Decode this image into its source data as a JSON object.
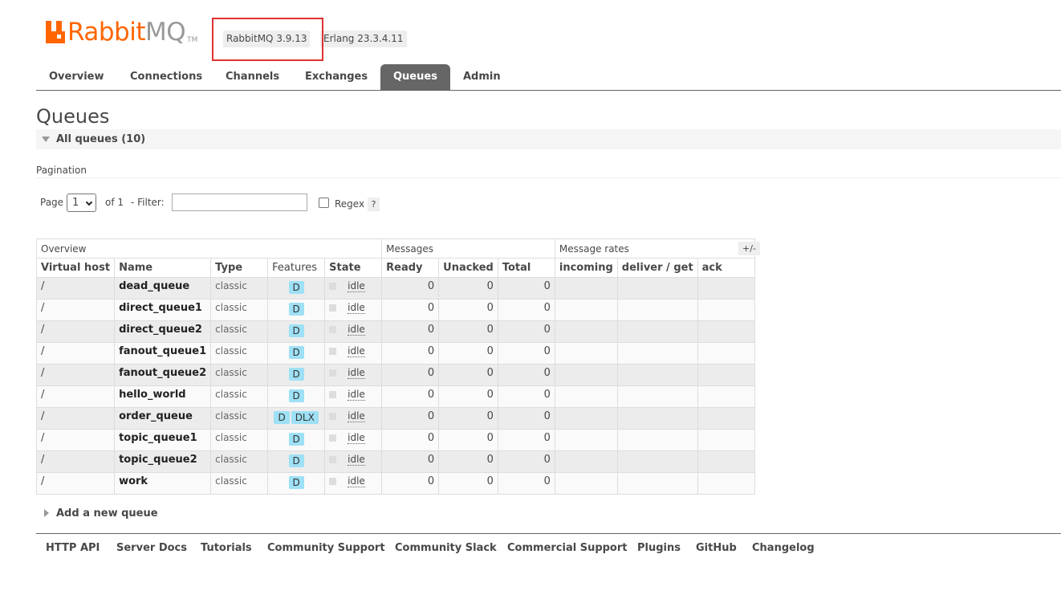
{
  "header": {
    "logo_rabbit": "Rabbit",
    "logo_mq": "MQ",
    "logo_tm": "TM",
    "rabbitmq_version": "RabbitMQ 3.9.13",
    "erlang_version": "Erlang 23.3.4.11"
  },
  "tabs": [
    "Overview",
    "Connections",
    "Channels",
    "Exchanges",
    "Queues",
    "Admin"
  ],
  "active_tab": "Queues",
  "page": {
    "title": "Queues",
    "section_title": "All queues (10)",
    "pagination_label": "Pagination",
    "page_label": "Page",
    "page_value": "1",
    "of_label": "of 1",
    "filter_label": "- Filter:",
    "filter_value": "",
    "regex_label": "Regex",
    "regex_help": "?",
    "column_toggle": "+/-",
    "add_queue_label": "Add a new queue"
  },
  "table": {
    "groups": [
      "Overview",
      "Messages",
      "Message rates"
    ],
    "columns": [
      "Virtual host",
      "Name",
      "Type",
      "Features",
      "State",
      "Ready",
      "Unacked",
      "Total",
      "incoming",
      "deliver / get",
      "ack"
    ],
    "rows": [
      {
        "vhost": "/",
        "name": "dead_queue",
        "type": "classic",
        "features": [
          "D"
        ],
        "state": "idle",
        "ready": "0",
        "unacked": "0",
        "total": "0"
      },
      {
        "vhost": "/",
        "name": "direct_queue1",
        "type": "classic",
        "features": [
          "D"
        ],
        "state": "idle",
        "ready": "0",
        "unacked": "0",
        "total": "0"
      },
      {
        "vhost": "/",
        "name": "direct_queue2",
        "type": "classic",
        "features": [
          "D"
        ],
        "state": "idle",
        "ready": "0",
        "unacked": "0",
        "total": "0"
      },
      {
        "vhost": "/",
        "name": "fanout_queue1",
        "type": "classic",
        "features": [
          "D"
        ],
        "state": "idle",
        "ready": "0",
        "unacked": "0",
        "total": "0"
      },
      {
        "vhost": "/",
        "name": "fanout_queue2",
        "type": "classic",
        "features": [
          "D"
        ],
        "state": "idle",
        "ready": "0",
        "unacked": "0",
        "total": "0"
      },
      {
        "vhost": "/",
        "name": "hello_world",
        "type": "classic",
        "features": [
          "D"
        ],
        "state": "idle",
        "ready": "0",
        "unacked": "0",
        "total": "0"
      },
      {
        "vhost": "/",
        "name": "order_queue",
        "type": "classic",
        "features": [
          "D",
          "DLX"
        ],
        "state": "idle",
        "ready": "0",
        "unacked": "0",
        "total": "0"
      },
      {
        "vhost": "/",
        "name": "topic_queue1",
        "type": "classic",
        "features": [
          "D"
        ],
        "state": "idle",
        "ready": "0",
        "unacked": "0",
        "total": "0"
      },
      {
        "vhost": "/",
        "name": "topic_queue2",
        "type": "classic",
        "features": [
          "D"
        ],
        "state": "idle",
        "ready": "0",
        "unacked": "0",
        "total": "0"
      },
      {
        "vhost": "/",
        "name": "work",
        "type": "classic",
        "features": [
          "D"
        ],
        "state": "idle",
        "ready": "0",
        "unacked": "0",
        "total": "0"
      }
    ]
  },
  "footer_links": [
    "HTTP API",
    "Server Docs",
    "Tutorials",
    "Community Support",
    "Community Slack",
    "Commercial Support",
    "Plugins",
    "GitHub",
    "Changelog"
  ],
  "colors": {
    "brand_orange": "#ff6600",
    "tab_active_bg": "#666666",
    "feature_badge": "#9ee0f5",
    "highlight_box": "#e03232"
  }
}
